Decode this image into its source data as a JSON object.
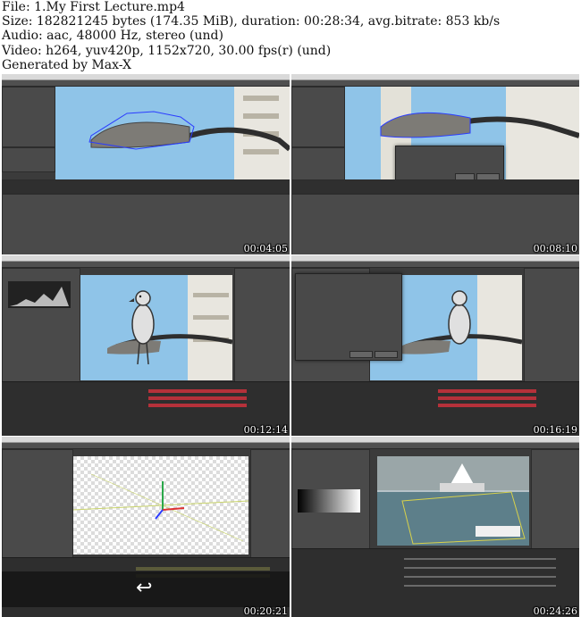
{
  "header": {
    "file_line": "File: 1.My First Lecture.mp4",
    "size_line": "Size: 182821245 bytes (174.35 MiB), duration: 00:28:34, avg.bitrate: 853 kb/s",
    "audio_line": "Audio: aac, 48000 Hz, stereo (und)",
    "video_line": "Video: h264, yuv420p, 1152x720, 30.00 fps(r) (und)",
    "generated_line": "Generated by Max-X"
  },
  "thumbnails": [
    {
      "timecode": "00:04:05"
    },
    {
      "timecode": "00:08:10"
    },
    {
      "timecode": "00:12:14"
    },
    {
      "timecode": "00:16:19"
    },
    {
      "timecode": "00:20:21"
    },
    {
      "timecode": "00:24:26"
    }
  ],
  "colors": {
    "sky": "#8fc4e8",
    "app_bg": "#3b3b3b",
    "timeline_red": "#b5313a",
    "spline_blue": "#2b3cff"
  },
  "icons": {
    "undo": "↩"
  }
}
